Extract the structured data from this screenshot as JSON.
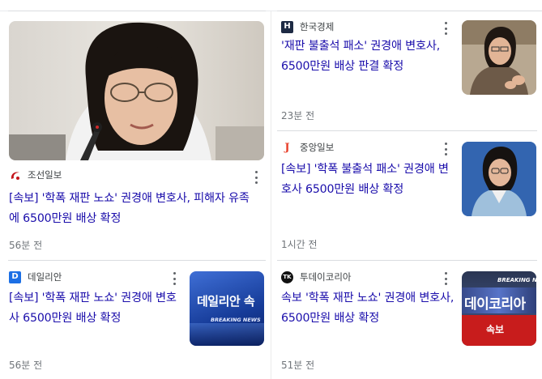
{
  "cards": [
    {
      "source": "조선일보",
      "logo_icon": "chosun-swoosh-icon",
      "logo_color": "#c4151c",
      "title": "[속보] '학폭 재판 노쇼' 권경애 변호사, 피해자 유족에 6500만원 배상 확정",
      "time": "56분 전"
    },
    {
      "source": "한국경제",
      "logo_icon": "hankyung-h-icon",
      "logo_color": "#1d2a44",
      "logo_text": "H",
      "title": "'재판 불출석 패소' 권경애 변호사, 6500만원 배상 판결 확정",
      "time": "23분 전"
    },
    {
      "source": "중앙일보",
      "logo_icon": "joongang-j-icon",
      "logo_color": "#e8412c",
      "logo_text": "J",
      "title": "[속보] '학폭 불출석 패소' 권경애 변호사 6500만원 배상 확정",
      "time": "1시간 전"
    },
    {
      "source": "데일리안",
      "logo_icon": "dailian-d-icon",
      "logo_color": "#1c6fe5",
      "logo_text": "D",
      "title": "[속보] '학폭 재판 노쇼' 권경애 변호사 6500만원 배상 확정",
      "time": "56분 전",
      "thumb_text": "데일리안 속",
      "thumb_sub": "BREAKING NEWS"
    },
    {
      "source": "투데이코리아",
      "logo_icon": "todaykorea-tk-icon",
      "logo_color": "#111111",
      "logo_text": "TK",
      "title": "속보 '학폭 재판 노쇼' 권경애 변호사, 6500만원 배상 확정",
      "time": "51분 전",
      "thumb_text": "데이코리아",
      "thumb_sub": "BREAKING NE",
      "thumb_badge": "속보"
    }
  ]
}
